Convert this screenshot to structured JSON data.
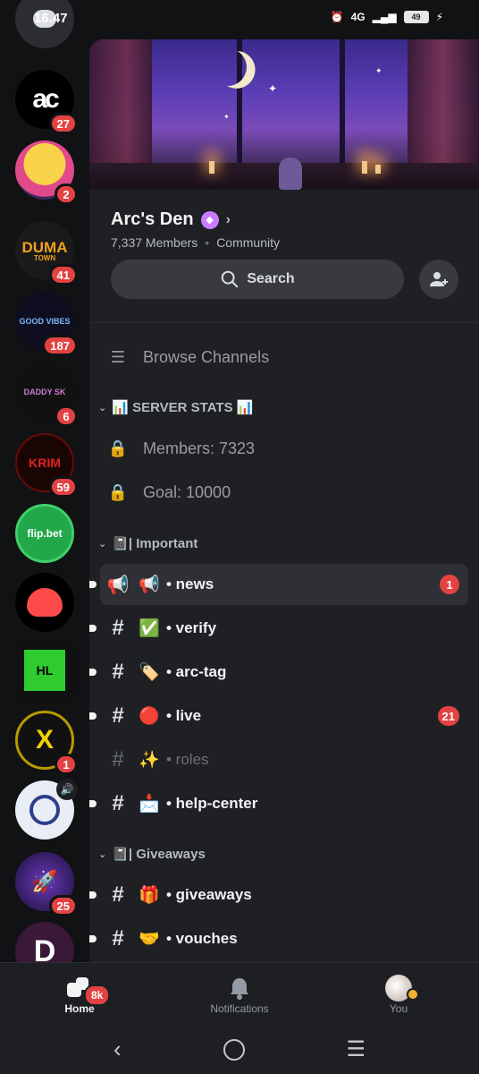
{
  "status_bar": {
    "time": "16.47",
    "network": "4G",
    "battery": "49"
  },
  "servers": [
    {
      "id": "discord-home",
      "badge": null
    },
    {
      "id": "ac",
      "label": "ac",
      "badge": "27"
    },
    {
      "id": "pink-mascot",
      "badge": "2"
    },
    {
      "id": "duma-town",
      "label": "DUMA",
      "sublabel": "TOWN",
      "badge": "41"
    },
    {
      "id": "good-vibes",
      "label": "GOOD VIBES",
      "badge": "187"
    },
    {
      "id": "daddy-skull",
      "label": "DADDY SK",
      "badge": "6"
    },
    {
      "id": "krim",
      "label": "KRIM",
      "badge": "59"
    },
    {
      "id": "flipbet",
      "label": "flip.bet",
      "badge": null
    },
    {
      "id": "red-blob",
      "badge": null
    },
    {
      "id": "hl",
      "label": "HL",
      "badge": null
    },
    {
      "id": "x-server",
      "label": "X",
      "badge": "1"
    },
    {
      "id": "planet-voice",
      "badge": null
    },
    {
      "id": "rocket",
      "badge": "25"
    },
    {
      "id": "d-server",
      "label": "D",
      "badge": null
    }
  ],
  "server": {
    "name": "Arc's Den",
    "members": "7,337 Members",
    "type": "Community",
    "search_label": "Search"
  },
  "browse_channels": "Browse Channels",
  "categories": {
    "stats": "📊 SERVER STATS 📊",
    "important": "📓| Important",
    "giveaways": "📓| Giveaways"
  },
  "stats_channels": [
    {
      "label": "Members: 7323"
    },
    {
      "label": "Goal: 10000"
    }
  ],
  "channels": [
    {
      "emoji": "📢",
      "name": "• news",
      "badge": "1"
    },
    {
      "emoji": "✅",
      "name": "• verify",
      "badge": null
    },
    {
      "emoji": "🏷️",
      "name": "• arc-tag",
      "badge": null
    },
    {
      "emoji": "🔴",
      "name": "• live",
      "badge": "21"
    },
    {
      "emoji": "✨",
      "name": "• roles",
      "badge": null
    },
    {
      "emoji": "📩",
      "name": "• help-center",
      "badge": null
    },
    {
      "emoji": "🎁",
      "name": "• giveaways",
      "badge": null
    },
    {
      "emoji": "🤝",
      "name": "• vouches",
      "badge": null
    }
  ],
  "nav": {
    "home": "Home",
    "home_badge": "8k",
    "notifications": "Notifications",
    "you": "You"
  },
  "colors": {
    "accent": "#e34242",
    "panel": "#1f2023",
    "rail": "#111214"
  }
}
